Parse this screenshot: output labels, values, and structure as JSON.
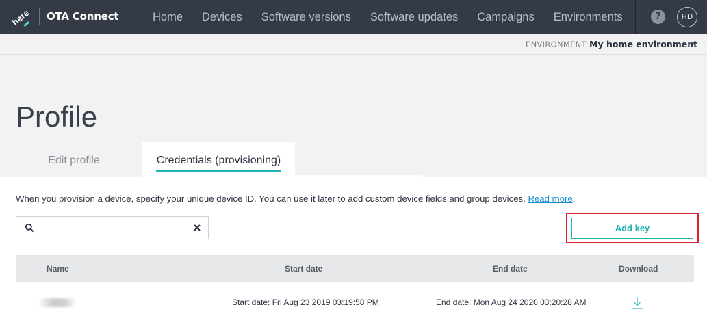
{
  "topbar": {
    "logo_text": "here",
    "app_title": "OTA Connect",
    "nav": [
      "Home",
      "Devices",
      "Software versions",
      "Software updates",
      "Campaigns",
      "Environments"
    ],
    "help_label": "?",
    "avatar_initials": "HD"
  },
  "environment": {
    "label": "ENVIRONMENT:",
    "value": "My home environment"
  },
  "page": {
    "title": "Profile",
    "tabs": [
      {
        "label": "Edit profile",
        "active": false
      },
      {
        "label": "Credentials (provisioning)",
        "active": true
      }
    ]
  },
  "intro": {
    "text": "When you provision a device, specify your unique device ID. You can use it later to add custom device fields and group devices.",
    "link": "Read more",
    "trailing": "."
  },
  "search": {
    "value": "",
    "placeholder": ""
  },
  "actions": {
    "add_key": "Add key"
  },
  "table": {
    "headers": [
      "Name",
      "Start date",
      "End date",
      "Download"
    ],
    "rows": [
      {
        "name": "",
        "start": "Start date: Fri Aug 23 2019 03:19:58 PM",
        "end": "End date: Mon Aug 24 2020 03:20:28 AM"
      }
    ]
  },
  "colors": {
    "topbar": "#343b47",
    "accent": "#1fb3b3",
    "highlight": "#d9252a",
    "link": "#1a8fd4"
  },
  "icons": [
    "here-logo",
    "help-icon",
    "chevron-down-icon",
    "search-icon",
    "clear-icon",
    "download-icon"
  ]
}
